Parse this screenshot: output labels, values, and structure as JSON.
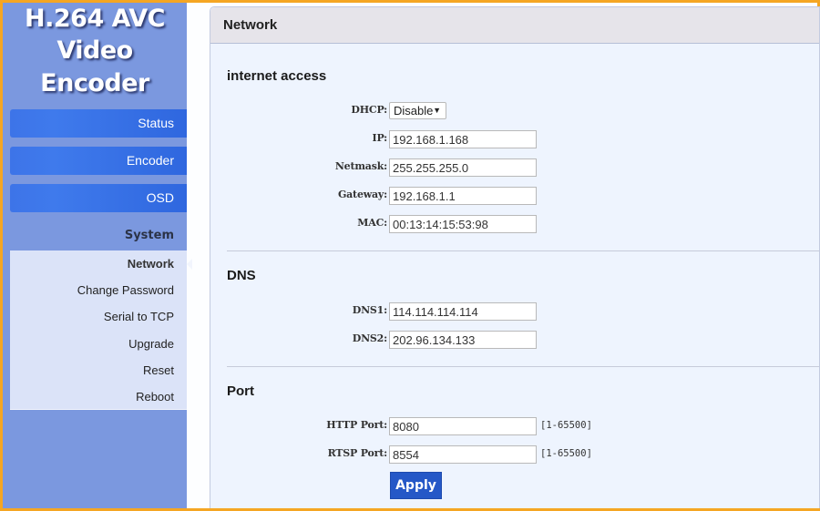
{
  "brand": {
    "line1": "H.264 AVC",
    "line2": "Video Encoder"
  },
  "sidebar": {
    "main_items": [
      {
        "label": "Status"
      },
      {
        "label": "Encoder"
      },
      {
        "label": "OSD"
      }
    ],
    "group_label": "System",
    "sub_items": [
      {
        "label": "Network",
        "active": true
      },
      {
        "label": "Change Password"
      },
      {
        "label": "Serial to TCP"
      },
      {
        "label": "Upgrade"
      },
      {
        "label": "Reset"
      },
      {
        "label": "Reboot"
      }
    ]
  },
  "panel": {
    "title": "Network",
    "sections": {
      "internet": {
        "title": "internet access",
        "dhcp": {
          "label": "DHCP:",
          "value": "Disable",
          "arrow": "▼"
        },
        "ip": {
          "label": "IP:",
          "value": "192.168.1.168"
        },
        "netmask": {
          "label": "Netmask:",
          "value": "255.255.255.0"
        },
        "gateway": {
          "label": "Gateway:",
          "value": "192.168.1.1"
        },
        "mac": {
          "label": "MAC:",
          "value": "00:13:14:15:53:98"
        }
      },
      "dns": {
        "title": "DNS",
        "dns1": {
          "label": "DNS1:",
          "value": "114.114.114.114"
        },
        "dns2": {
          "label": "DNS2:",
          "value": "202.96.134.133"
        }
      },
      "port": {
        "title": "Port",
        "http": {
          "label": "HTTP Port:",
          "value": "8080",
          "hint": "[1-65500]"
        },
        "rtsp": {
          "label": "RTSP Port:",
          "value": "8554",
          "hint": "[1-65500]"
        }
      }
    },
    "apply_label": "Apply"
  },
  "colors": {
    "frame_border": "#f5a623",
    "sidebar_bg": "#7b98df",
    "nav_button": "#3d74e8",
    "apply_button": "#2558c7"
  }
}
